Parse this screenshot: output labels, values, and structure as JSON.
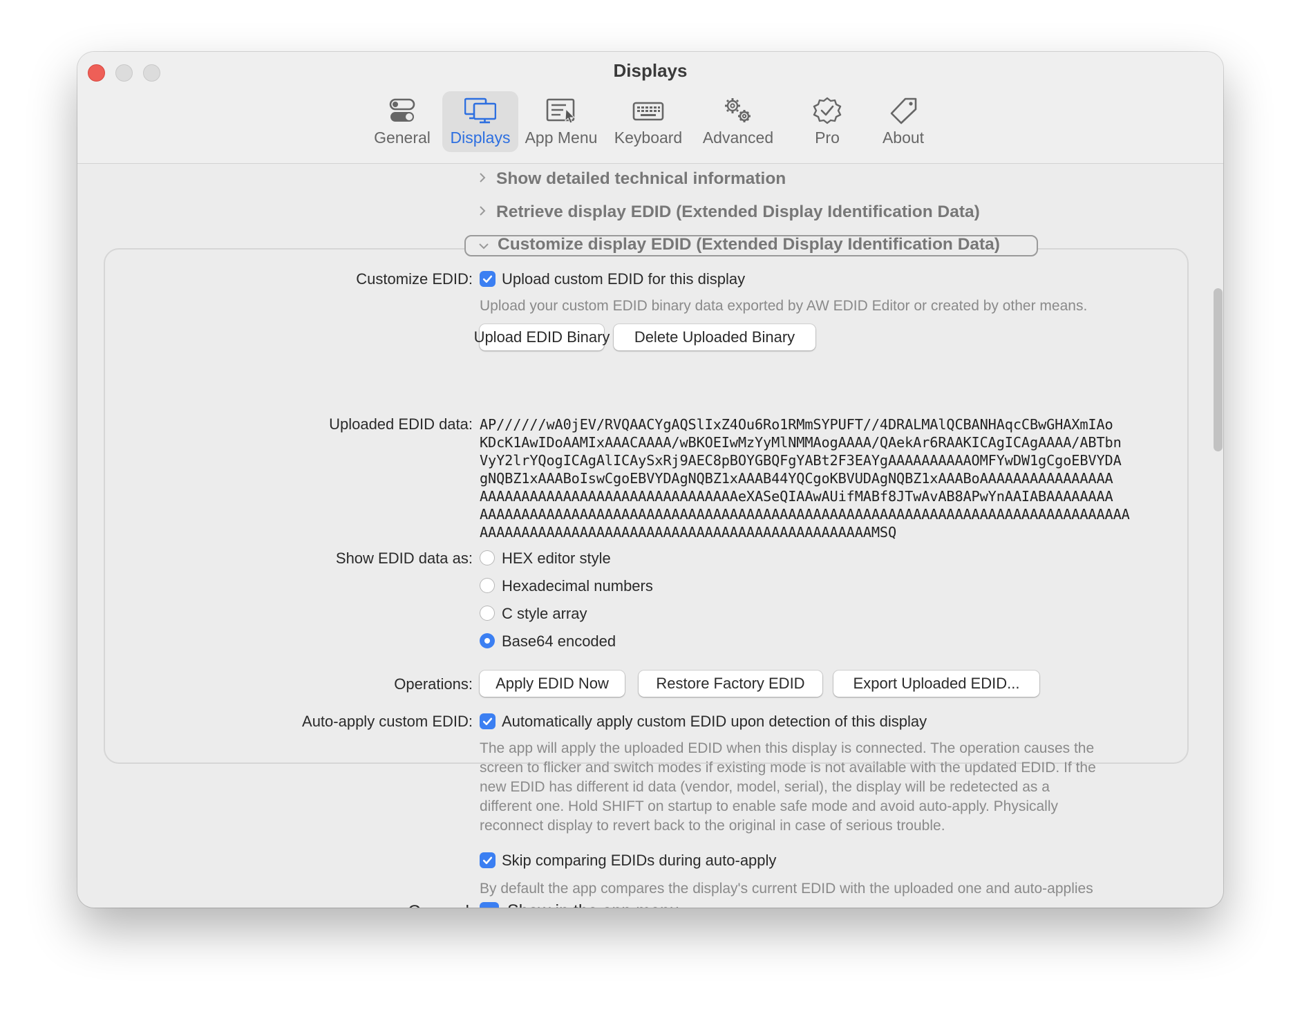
{
  "window": {
    "title": "Displays"
  },
  "tabs": [
    {
      "label": "General",
      "icon": "toggles-icon"
    },
    {
      "label": "Displays",
      "icon": "displays-icon",
      "active": true
    },
    {
      "label": "App Menu",
      "icon": "app-menu-icon"
    },
    {
      "label": "Keyboard",
      "icon": "keyboard-icon"
    },
    {
      "label": "Advanced",
      "icon": "gears-icon"
    },
    {
      "label": "Pro",
      "icon": "checkmark-seal-icon"
    },
    {
      "label": "About",
      "icon": "tag-icon"
    }
  ],
  "sections": {
    "technical": "Show detailed technical information",
    "retrieve": "Retrieve display EDID (Extended Display Identification Data)",
    "customize": "Customize display EDID (Extended Display Identification Data)"
  },
  "customize": {
    "label": "Customize EDID:",
    "checkbox": "Upload custom EDID for this display",
    "checked": true,
    "note": "Upload your custom EDID binary data exported by AW EDID Editor or created by other means.",
    "upload_button": "Upload EDID Binary",
    "delete_button": "Delete Uploaded Binary"
  },
  "uploaded": {
    "label": "Uploaded EDID data:",
    "lines": [
      "AP//////wA0jEV/RVQAACYgAQSlIxZ4Ou6Ro1RMmSYPUFT//4DRALMAlQCBANHAqcCBwGHAXmIAo",
      "KDcK1AwIDoAAMIxAAACAAAA/wBKOEIwMzYyMlNMMAogAAAA/QAekAr6RAAKICAgICAgAAAA/ABTbn",
      "VyY2lrYQogICAgAlICAySxRj9AEC8pBOYGBQFgYABt2F3EAYgAAAAAAAAAAOMFYwDW1gCgoEBVYDA",
      "gNQBZ1xAAABoIswCgoEBVYDAgNQBZ1xAAAB44YQCgoKBVUDAgNQBZ1xAAABoAAAAAAAAAAAAAAAA",
      "AAAAAAAAAAAAAAAAAAAAAAAAAAAAAAAeXASeQIAAwAUifMABf8JTwAvAB8APwYnAAIABAAAAAAAA",
      "AAAAAAAAAAAAAAAAAAAAAAAAAAAAAAAAAAAAAAAAAAAAAAAAAAAAAAAAAAAAAAAAAAAAAAAAAAAAAA",
      "AAAAAAAAAAAAAAAAAAAAAAAAAAAAAAAAAAAAAAAAAAAAAAAMSQ"
    ]
  },
  "show_as": {
    "label": "Show EDID data as:",
    "options": [
      "HEX editor style",
      "Hexadecimal numbers",
      "C style array",
      "Base64 encoded"
    ],
    "selected": "Base64 encoded"
  },
  "operations": {
    "label": "Operations:",
    "apply": "Apply EDID Now",
    "restore": "Restore Factory EDID",
    "export": "Export Uploaded EDID..."
  },
  "auto_apply": {
    "label": "Auto-apply custom EDID:",
    "checkbox": "Automatically apply custom EDID upon detection of this display",
    "checked": true,
    "note_lines": [
      "The app will apply the uploaded EDID when this display is connected. The operation causes the",
      "screen to flicker and switch modes if existing mode is not available with the updated EDID. If the",
      "new EDID has different id data (vendor, model, serial), the display will be redetected as a",
      "different one. Hold SHIFT on startup to enable safe mode and avoid auto-apply. Physically",
      "reconnect  display to revert back to the original in case of serious trouble."
    ],
    "skip_checkbox": "Skip comparing EDIDs during auto-apply",
    "skip_checked": true,
    "skip_note": "By default the app compares the display's current EDID with the uploaded one and auto-applies"
  },
  "general": {
    "label": "General:",
    "checkbox": "Show in the app menu",
    "checked": true
  },
  "colors": {
    "accent": "#3b7ff2",
    "active_tab_text": "#2d6fe0",
    "close": "#ee5f57"
  }
}
